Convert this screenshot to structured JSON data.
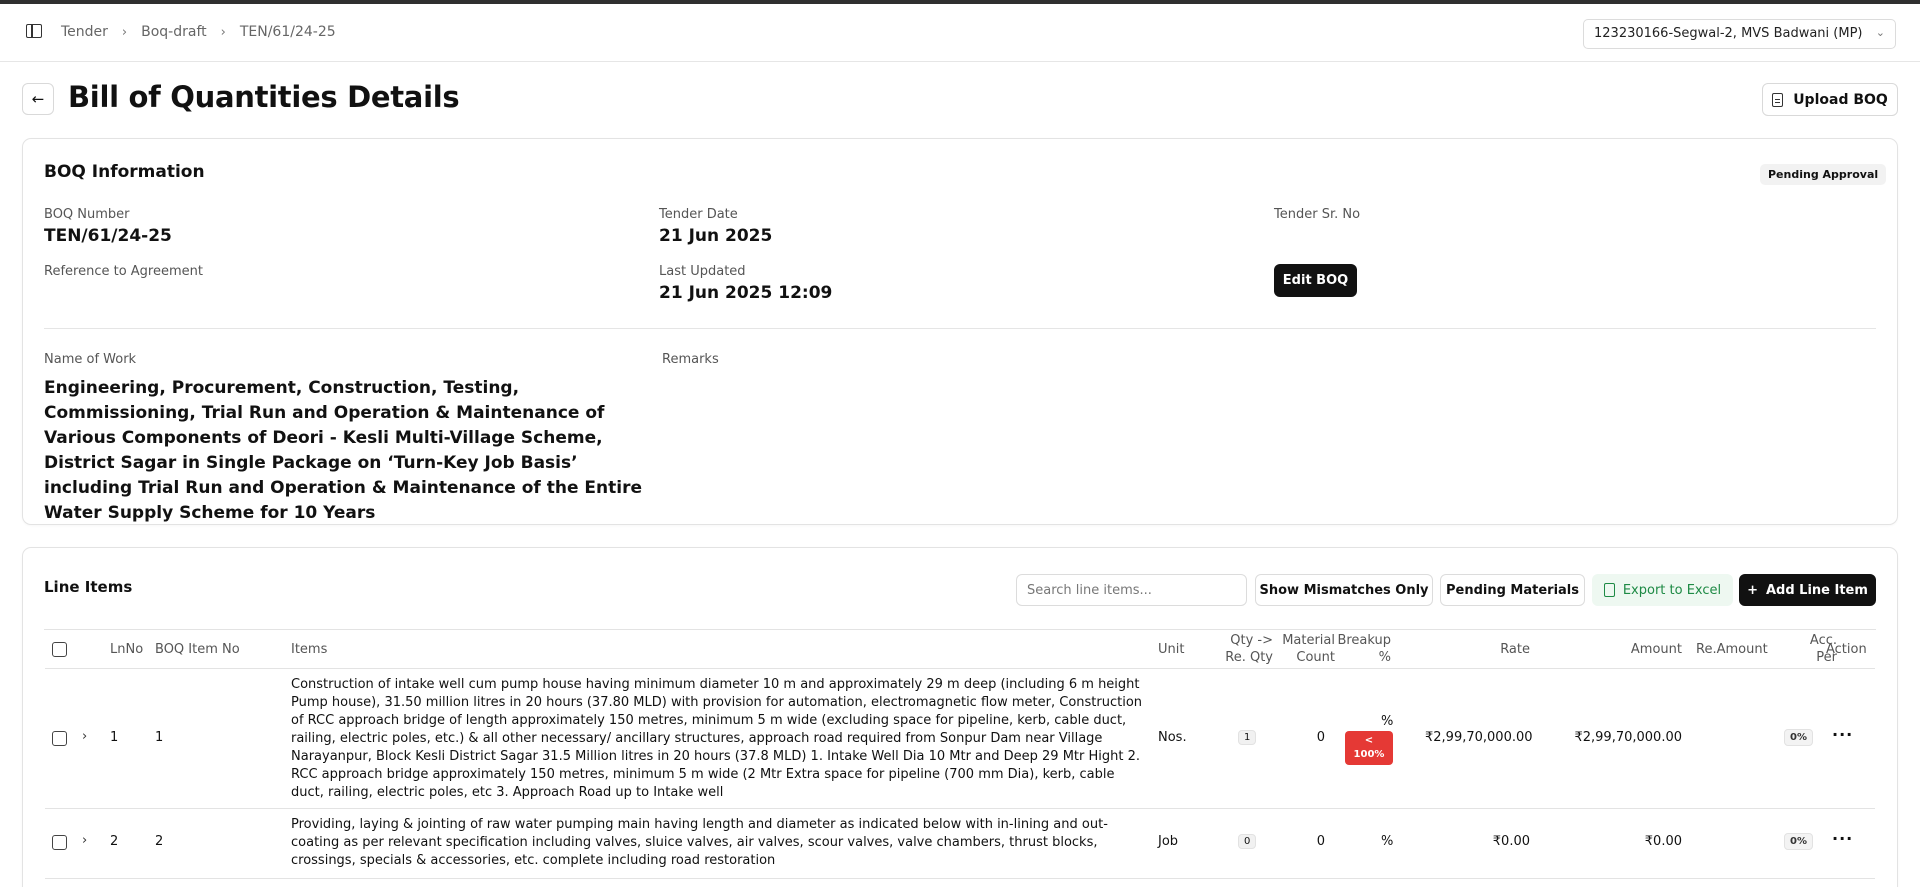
{
  "breadcrumb": [
    "Tender",
    "Boq-draft",
    "TEN/61/24-25"
  ],
  "site_selector": "123230166-Segwal-2, MVS Badwani (MP)",
  "page_title": "Bill of Quantities Details",
  "upload_label": "Upload BOQ",
  "info": {
    "title": "BOQ Information",
    "status": "Pending Approval",
    "boq_number_label": "BOQ Number",
    "boq_number": "TEN/61/24-25",
    "tender_date_label": "Tender Date",
    "tender_date": "21 Jun 2025",
    "tender_sr_label": "Tender Sr. No",
    "reference_label": "Reference to Agreement",
    "last_updated_label": "Last Updated",
    "last_updated": "21 Jun 2025 12:09",
    "edit_label": "Edit BOQ",
    "name_of_work_label": "Name of Work",
    "name_of_work": "Engineering, Procurement, Construction, Testing, Commissioning, Trial Run and Operation & Maintenance of Various Components of Deori - Kesli Multi-Village Scheme, District Sagar in Single Package on ‘Turn-Key Job Basis’ including Trial Run and Operation & Maintenance of the Entire Water Supply Scheme for 10 Years",
    "remarks_label": "Remarks"
  },
  "line_items": {
    "title": "Line Items",
    "search_placeholder": "Search line items...",
    "show_mismatches": "Show Mismatches Only",
    "pending_materials": "Pending Materials",
    "export": "Export to Excel",
    "add": "Add Line Item",
    "columns": {
      "lnno": "LnNo",
      "boq_item_no": "BOQ Item No",
      "items": "Items",
      "unit": "Unit",
      "qty_line1": "Qty ->",
      "qty_line2": "Re. Qty",
      "mat_line1": "Material",
      "mat_line2": "Count",
      "breakup_line1": "Breakup",
      "breakup_line2": "%",
      "rate": "Rate",
      "amount": "Amount",
      "re_amount": "Re.Amount",
      "acc_line1": "Acc.",
      "acc_line2": "Per",
      "action": "Action"
    },
    "rows": [
      {
        "lnno": "1",
        "boq_item_no": "1",
        "item": "Construction of intake well cum pump house having minimum diameter 10 m and approximately 29 m deep (including 6 m height Pump house), 31.50 million litres in 20 hours (37.80 MLD) with provision for automation, electromagnetic flow meter, Construction of RCC approach bridge of length approximately 150 metres, minimum 5 m wide (excluding space for pipeline, kerb, cable duct, railing, electric poles, etc.) & all other necessary/ ancillary structures, approach road required from Sonpur Dam near Village Narayanpur, Block Kesli District Sagar 31.5 Million litres in 20 hours (37.8 MLD) 1. Intake Well Dia 10 Mtr and Deep 29 Mtr Hight 2. RCC approach bridge approximately 150 metres, minimum 5 m wide (2 Mtr Extra space for pipeline (700 mm Dia), kerb, cable duct, railing, electric poles, etc 3. Approach Road up to Intake well",
        "unit": "Nos.",
        "qty": "1",
        "material_count": "0",
        "breakup_top": "%",
        "breakup_badge_1": "<",
        "breakup_badge_2": "100%",
        "rate": "₹2,99,70,000.00",
        "amount": "₹2,99,70,000.00",
        "re_amount": "",
        "acc_per": "0%"
      },
      {
        "lnno": "2",
        "boq_item_no": "2",
        "item": "Providing, laying & jointing of raw water pumping main having length and diameter as indicated below with in-lining and out-coating as per relevant specification including valves, sluice valves, air valves, scour valves, valve chambers, thrust blocks, crossings, specials & accessories, etc. complete including road restoration",
        "unit": "Job",
        "qty": "0",
        "material_count": "0",
        "breakup_top": "%",
        "rate": "₹0.00",
        "amount": "₹0.00",
        "re_amount": "",
        "acc_per": "0%"
      }
    ]
  },
  "colors": {
    "primary": "#111111",
    "danger": "#e53935",
    "excel_green": "#1e8a45"
  }
}
